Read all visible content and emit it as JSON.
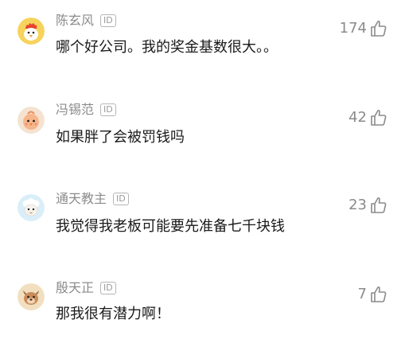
{
  "comments": [
    {
      "username": "陈玄风",
      "badge": "ID",
      "text": "哪个好公司。我的奖金基数很大。。",
      "likes": "174",
      "avatar_icon": "chicken-icon",
      "avatar_bg": "#f6d35c"
    },
    {
      "username": "冯锡范",
      "badge": "ID",
      "text": "如果胖了会被罚钱吗",
      "likes": "42",
      "avatar_icon": "chick-icon",
      "avatar_bg": "#f4e3d0"
    },
    {
      "username": "通天教主",
      "badge": "ID",
      "text": "我觉得我老板可能要先准备七千块钱",
      "likes": "23",
      "avatar_icon": "sheep-icon",
      "avatar_bg": "#d9eef8"
    },
    {
      "username": "殷天正",
      "badge": "ID",
      "text": "那我很有潜力啊！",
      "likes": "7",
      "avatar_icon": "dog-icon",
      "avatar_bg": "#f1dfbf"
    }
  ],
  "colors": {
    "username": "#8b8b8b",
    "text": "#1a1a1a",
    "likes": "#8b8b8b"
  }
}
